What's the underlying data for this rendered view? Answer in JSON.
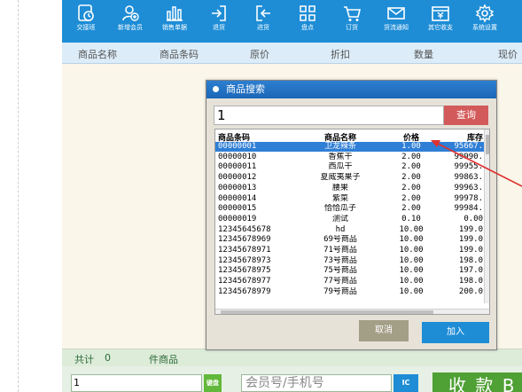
{
  "toolbar": {
    "buttons": [
      {
        "label": "交接班",
        "icon": "shift-change-icon"
      },
      {
        "label": "新增会员",
        "icon": "add-member-icon"
      },
      {
        "label": "销售单据",
        "icon": "sales-receipt-icon"
      },
      {
        "label": "退货",
        "icon": "return-icon"
      },
      {
        "label": "进货",
        "icon": "purchase-icon"
      },
      {
        "label": "盘点",
        "icon": "inventory-icon"
      },
      {
        "label": "订货",
        "icon": "cart-icon"
      },
      {
        "label": "货流通知",
        "icon": "mail-icon"
      },
      {
        "label": "其它收支",
        "icon": "finance-icon"
      },
      {
        "label": "系统设置",
        "icon": "gear-icon"
      }
    ]
  },
  "columns": [
    "商品名称",
    "商品条码",
    "原价",
    "折扣",
    "数量",
    "现价"
  ],
  "status": {
    "total_label": "共计",
    "total_value": "0",
    "items_label": "件商品"
  },
  "input_bar": {
    "quantity": "1",
    "keyboard_label": "键盘",
    "member_placeholder": "会员号/手机号",
    "ic_label": "IC",
    "pay_label": "收 款 B"
  },
  "dialog": {
    "title": "商品搜索",
    "search_value": "1",
    "search_button": "查询",
    "headers": [
      "商品条码",
      "商品名称",
      "价格",
      "库存"
    ],
    "rows": [
      [
        "00000001",
        "卫龙辣条",
        "1.00",
        "95667."
      ],
      [
        "00000010",
        "香蕉干",
        "2.00",
        "99990."
      ],
      [
        "00000011",
        "西瓜干",
        "2.00",
        "99955."
      ],
      [
        "00000012",
        "夏威夷果子",
        "2.00",
        "99863."
      ],
      [
        "00000013",
        "腰果",
        "2.00",
        "99963."
      ],
      [
        "00000014",
        "紫菜",
        "2.00",
        "99978."
      ],
      [
        "00000015",
        "恰恰瓜子",
        "2.00",
        "99984."
      ],
      [
        "00000019",
        "测试",
        "0.10",
        "0.00"
      ],
      [
        "12345645678",
        "hd",
        "10.00",
        "199.0"
      ],
      [
        "12345678969",
        "69号商品",
        "10.00",
        "199.0"
      ],
      [
        "12345678971",
        "71号商品",
        "10.00",
        "199.0"
      ],
      [
        "12345678973",
        "73号商品",
        "10.00",
        "198.0"
      ],
      [
        "12345678975",
        "75号商品",
        "10.00",
        "197.0"
      ],
      [
        "12345678977",
        "77号商品",
        "10.00",
        "198.0"
      ],
      [
        "12345678979",
        "79号商品",
        "10.00",
        "200.0"
      ]
    ],
    "selected_row": 0,
    "cancel_button": "取消",
    "add_button": "加入"
  },
  "colors": {
    "toolbar": "#1e8dd6",
    "selection": "#2f7fd6",
    "search_button": "#d35a5a",
    "pay_button": "#4fa035",
    "arrow": "#e03030"
  }
}
